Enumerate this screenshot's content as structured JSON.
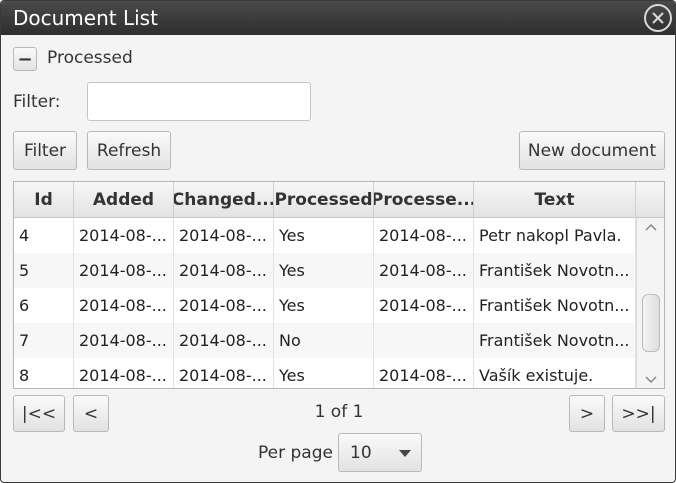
{
  "window": {
    "title": "Document List"
  },
  "section": {
    "toggle_label": "−",
    "label": "Processed"
  },
  "filter": {
    "label": "Filter:",
    "value": "",
    "placeholder": ""
  },
  "toolbar": {
    "filter_label": "Filter",
    "refresh_label": "Refresh",
    "new_document_label": "New document"
  },
  "table": {
    "columns": [
      "Id",
      "Added",
      "Changed...",
      "Processed",
      "Processe...",
      "Text"
    ],
    "rows": [
      [
        "4",
        "2014-08-...",
        "2014-08-...",
        "Yes",
        "2014-08-...",
        "Petr nakopl Pavla."
      ],
      [
        "5",
        "2014-08-...",
        "2014-08-...",
        "Yes",
        "2014-08-...",
        "František Novotn..."
      ],
      [
        "6",
        "2014-08-...",
        "2014-08-...",
        "Yes",
        "2014-08-...",
        "František Novotn..."
      ],
      [
        "7",
        "2014-08-...",
        "2014-08-...",
        "No",
        "",
        "František Novotn..."
      ],
      [
        "8",
        "2014-08-...",
        "2014-08-...",
        "Yes",
        "2014-08-...",
        "Vašík existuje."
      ]
    ]
  },
  "pagination": {
    "first_label": "|<<",
    "prev_label": "<",
    "page_info": "1 of 1",
    "next_label": ">",
    "last_label": ">>|"
  },
  "per_page": {
    "label": "Per page",
    "value": "10"
  },
  "icons": {
    "close": "close-icon",
    "dropdown": "chevron-down-icon",
    "scroll_up": "chevron-up-icon",
    "scroll_down": "chevron-down-icon"
  },
  "colors": {
    "titlebar": "#3a3a3a",
    "window_bg": "#f4f4f4"
  }
}
